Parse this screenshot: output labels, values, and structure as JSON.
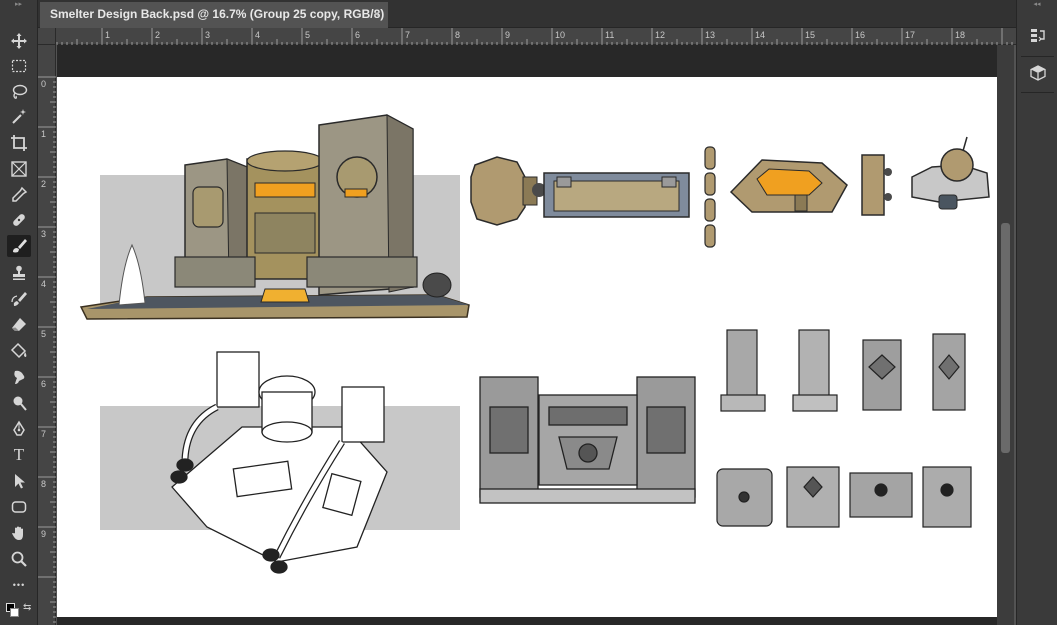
{
  "document": {
    "tab_title": "Smelter Design Back.psd @ 16.7% (Group 25 copy, RGB/8) *",
    "close_glyph": "×"
  },
  "ruler": {
    "top_numbers": [
      "1",
      "2",
      "3",
      "4",
      "5",
      "6",
      "7",
      "8",
      "9",
      "10",
      "11",
      "12",
      "13",
      "14",
      "15",
      "16",
      "17",
      "18"
    ],
    "left_numbers": [
      "0",
      "1",
      "2",
      "3",
      "4",
      "5",
      "6",
      "7",
      "8",
      "9"
    ]
  },
  "toolbar": {
    "tools": [
      {
        "name": "move-tool",
        "icon": "move-icon"
      },
      {
        "name": "marquee-tool",
        "icon": "rectangle-marquee-icon"
      },
      {
        "name": "lasso-tool",
        "icon": "lasso-icon"
      },
      {
        "name": "magic-wand-tool",
        "icon": "magic-wand-icon"
      },
      {
        "name": "crop-tool",
        "icon": "crop-icon"
      },
      {
        "name": "frame-tool",
        "icon": "frame-icon"
      },
      {
        "name": "eyedropper-tool",
        "icon": "eyedropper-icon"
      },
      {
        "name": "healing-brush-tool",
        "icon": "bandage-icon"
      },
      {
        "name": "brush-tool",
        "icon": "brush-icon",
        "active": true
      },
      {
        "name": "clone-stamp-tool",
        "icon": "stamp-icon"
      },
      {
        "name": "history-brush-tool",
        "icon": "history-brush-icon"
      },
      {
        "name": "eraser-tool",
        "icon": "eraser-icon"
      },
      {
        "name": "paint-bucket-tool",
        "icon": "paint-bucket-icon"
      },
      {
        "name": "smudge-tool",
        "icon": "smudge-icon"
      },
      {
        "name": "dodge-tool",
        "icon": "dodge-icon"
      },
      {
        "name": "pen-tool",
        "icon": "pen-icon"
      },
      {
        "name": "type-tool",
        "icon": "type-icon",
        "glyph": "T"
      },
      {
        "name": "path-selection-tool",
        "icon": "arrow-icon"
      },
      {
        "name": "shape-tool",
        "icon": "rounded-rectangle-icon"
      },
      {
        "name": "hand-tool",
        "icon": "hand-icon"
      },
      {
        "name": "zoom-tool",
        "icon": "zoom-icon"
      },
      {
        "name": "more-tools",
        "icon": "more-icon",
        "glyph": "•••"
      }
    ]
  },
  "right_panel": {
    "buttons": [
      {
        "name": "history-panel-button",
        "icon": "history-icon"
      },
      {
        "name": "3d-panel-button",
        "icon": "cube-icon"
      }
    ]
  },
  "colors": {
    "accent_gold": "#b8a474",
    "glow_orange": "#f0a020",
    "stone_gray": "#9a9a9a",
    "canvas_bg": "#ffffff",
    "backdrop_gray": "#c8c8c8"
  }
}
